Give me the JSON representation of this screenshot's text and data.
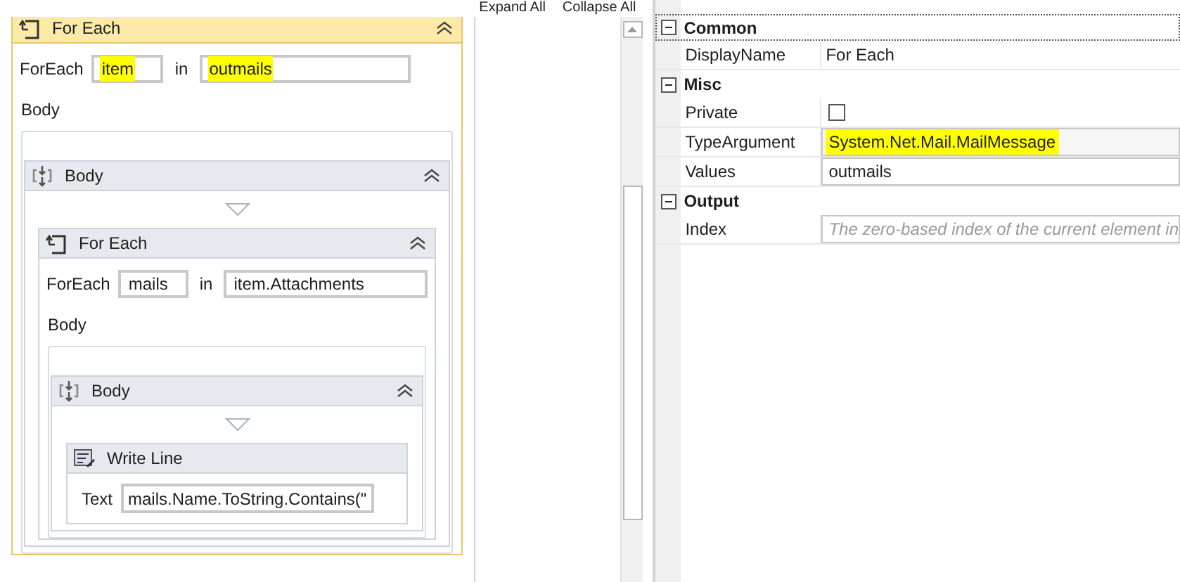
{
  "toolbar": {
    "expand_all": "Expand All",
    "collapse_all": "Collapse All"
  },
  "designer": {
    "kind": "foreach",
    "title": "For Each",
    "selected": true,
    "expanded": true,
    "item_label": "ForEach",
    "variable": {
      "value": "item",
      "highlighted": true
    },
    "in_label": "in",
    "values": {
      "value": "outmails",
      "highlighted": true
    },
    "body_label": "Body",
    "body": {
      "kind": "sequence",
      "title": "Body",
      "selected": false,
      "expanded": true,
      "children": [
        {
          "kind": "foreach",
          "title": "For Each",
          "selected": false,
          "expanded": true,
          "item_label": "ForEach",
          "variable": {
            "value": "mails",
            "highlighted": false
          },
          "in_label": "in",
          "values": {
            "value": "item.Attachments",
            "highlighted": false
          },
          "body_label": "Body",
          "body": {
            "kind": "sequence",
            "title": "Body",
            "selected": false,
            "expanded": true,
            "children": [
              {
                "kind": "writeline",
                "title": "Write Line",
                "selected": false,
                "text_label": "Text",
                "text_value": "mails.Name.ToString.Contains(\""
              }
            ]
          }
        }
      ]
    }
  },
  "properties": {
    "categories": [
      {
        "name": "Common",
        "expanded": true,
        "focused": true,
        "properties": [
          {
            "name": "DisplayName",
            "kind": "text",
            "value": "For Each"
          }
        ]
      },
      {
        "name": "Misc",
        "expanded": true,
        "focused": false,
        "properties": [
          {
            "name": "Private",
            "kind": "checkbox",
            "checked": false
          },
          {
            "name": "TypeArgument",
            "kind": "dropdown",
            "value": "System.Net.Mail.MailMessage",
            "highlighted": true
          },
          {
            "name": "Values",
            "kind": "box",
            "value": "outmails",
            "highlighted": false
          }
        ]
      },
      {
        "name": "Output",
        "expanded": true,
        "focused": false,
        "properties": [
          {
            "name": "Index",
            "kind": "box",
            "placeholder": "The zero-based index of the current element in"
          }
        ]
      }
    ]
  }
}
